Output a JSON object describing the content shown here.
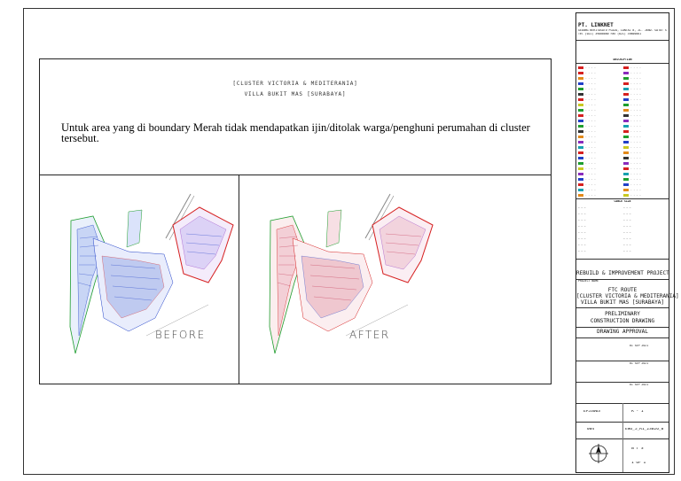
{
  "header": {
    "line1": "[CLUSTER VICTORIA & MEDITERANIA]",
    "line2": "VILLA BUKIT MAS [SURABAYA]"
  },
  "note": "Untuk area yang di boundary Merah tidak mendapatkan ijin/ditolak warga/penghuni perumahan di cluster tersebut.",
  "panels": {
    "before_label": "BEFORE",
    "after_label": "AFTER"
  },
  "title_block": {
    "company": "PT. LINKNET",
    "company_address": "GEDUNG BERITASATU PLAZA, LANTAI 8, JL. JEND. GATOT SUBROTO KAV. 35-36",
    "company_phone": "Tel (021) 39800000   Fax (021) 39800001",
    "legend_title": "DESCRIPTION",
    "scale_label": "CABLE SIZE",
    "project_type": "REBUILD & IMPROVEMENT PROJECT",
    "project_name_label": "PROJECT NAME",
    "project_name_1": "FTC ROUTE",
    "project_name_2": "[CLUSTER VICTORIA & MEDITERANIA]",
    "project_name_3": "VILLA BUKIT MAS [SURABAYA]",
    "stage_1": "PRELIMINARY",
    "stage_2": "CONSTRUCTION DRAWING",
    "approval": "DRAWING APPROVAL",
    "date_1": "01 SEP 2021",
    "date_2": "01 SEP 2021",
    "date_3": "01 SEP 2021",
    "doc_code": "EP53003",
    "rev": "R - 1",
    "sheet_no": "004",
    "drawing_no": "ENG_5_R1_23026_0",
    "scale_value": "N T S",
    "page": "1 OF 1"
  },
  "legend_colors": [
    "#d62020",
    "#1e9e2e",
    "#2040c8",
    "#e38a1a",
    "#8a2bbd",
    "#16a0b0",
    "#333333",
    "#c9c921"
  ]
}
